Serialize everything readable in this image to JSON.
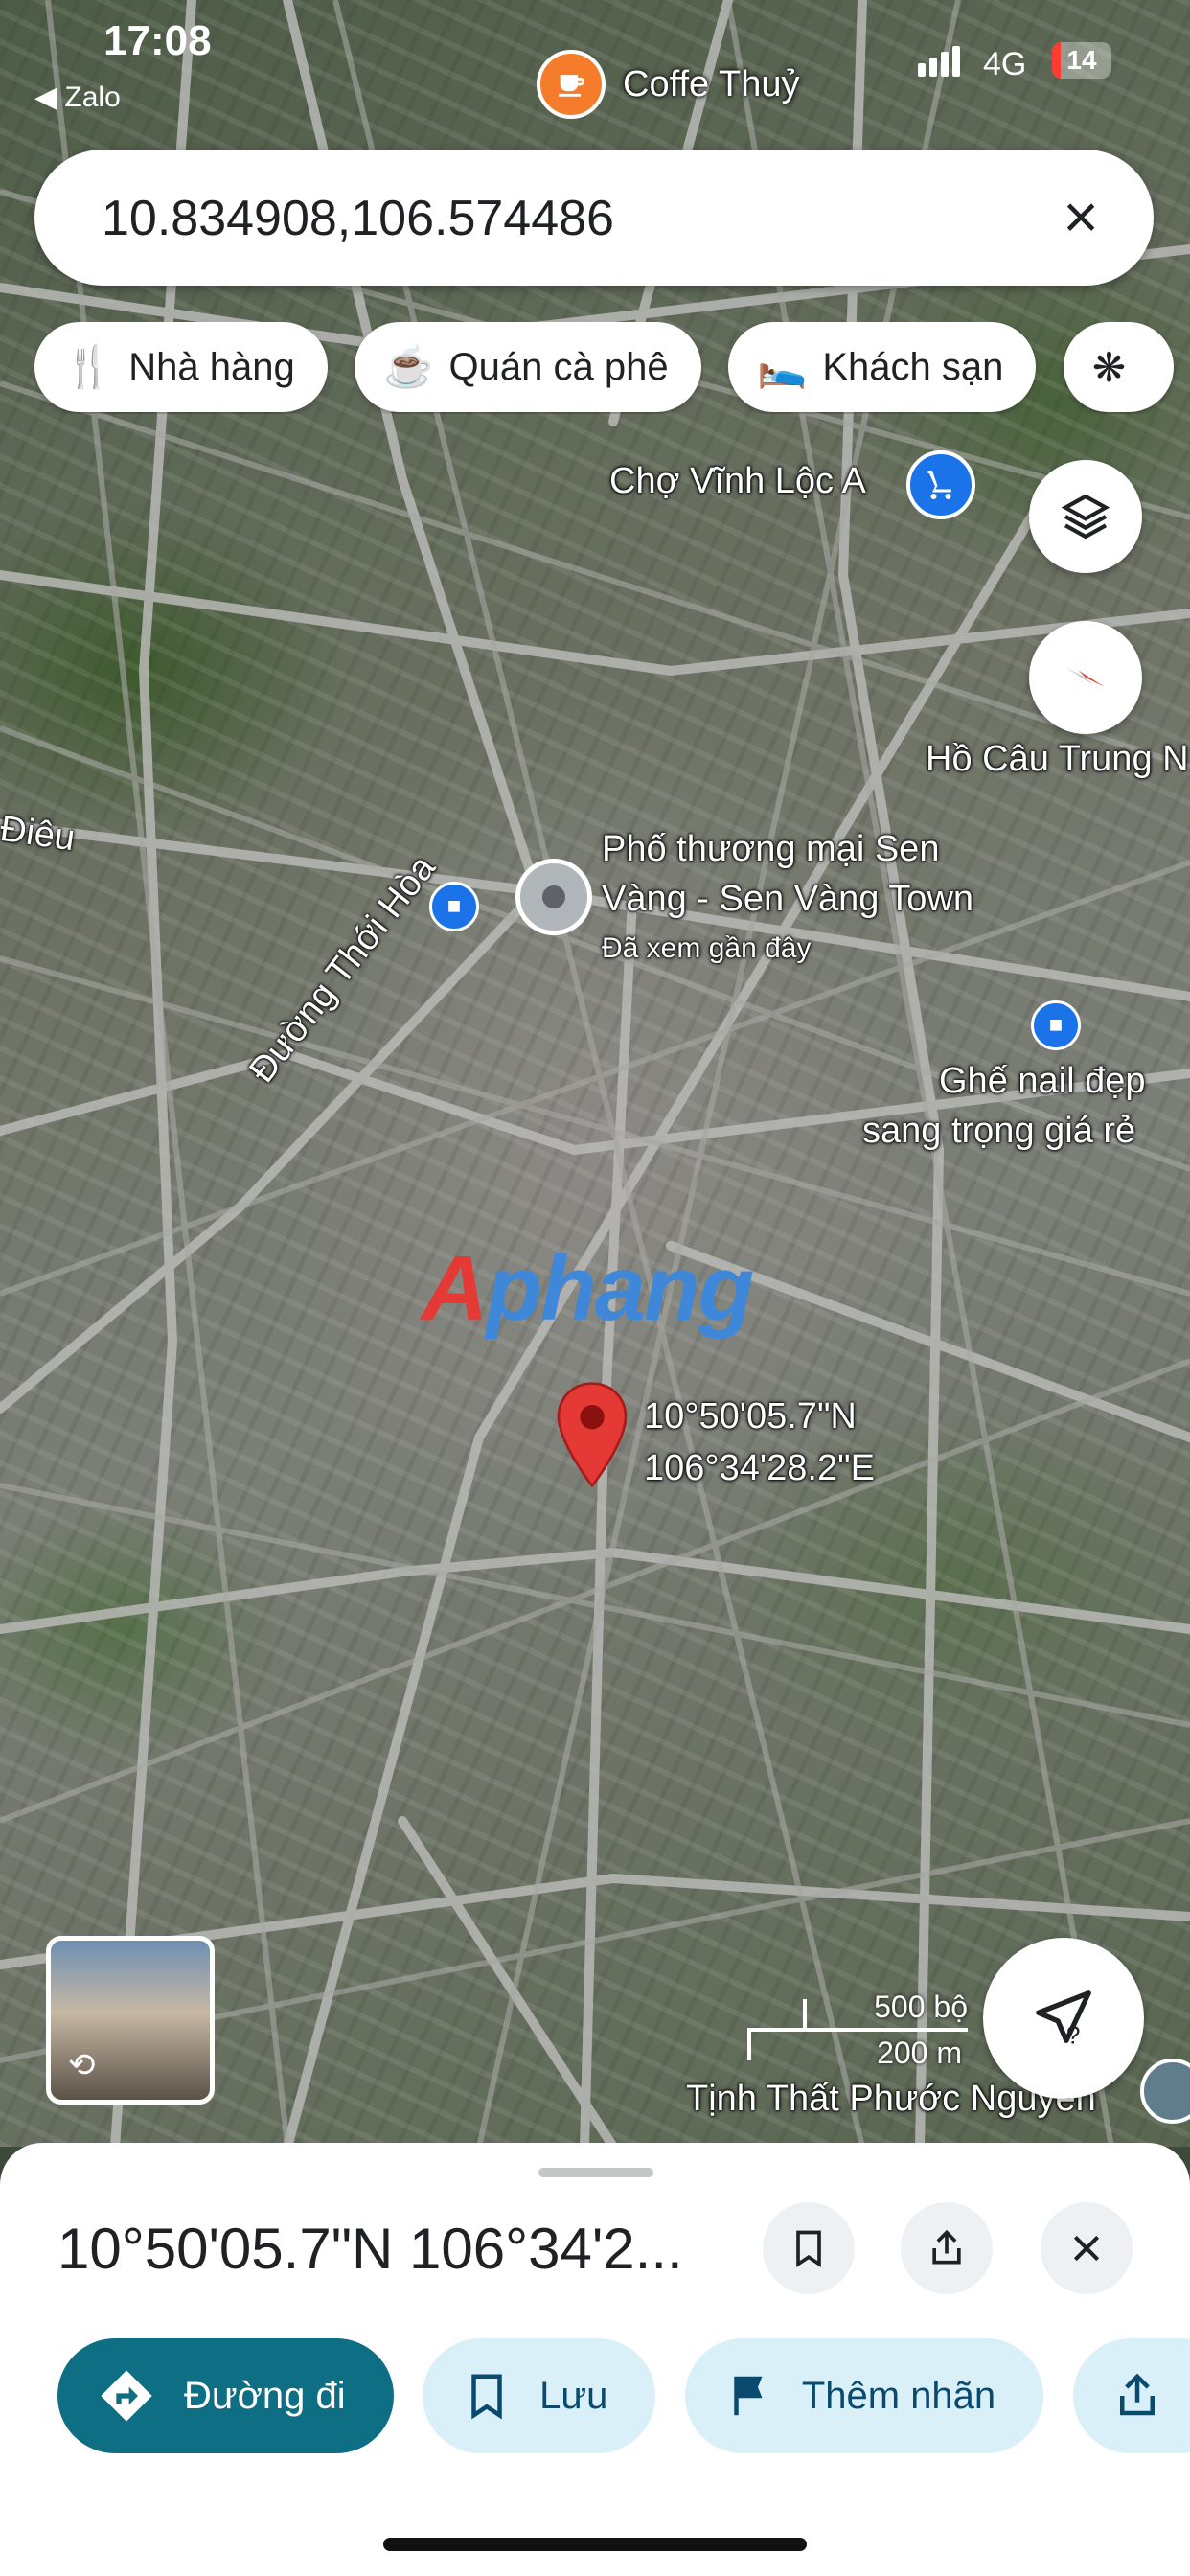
{
  "status_bar": {
    "time": "17:08",
    "back_app": "Zalo",
    "network": "4G",
    "battery": "14",
    "battery_level": 0.14
  },
  "top_poi": {
    "label": "Coffe Thuỷ"
  },
  "search": {
    "value": "10.834908,106.574486"
  },
  "chips": [
    {
      "label": "Nhà hàng",
      "icon": "fork-knife-icon"
    },
    {
      "label": "Quán cà phê",
      "icon": "coffee-cup-icon"
    },
    {
      "label": "Khách sạn",
      "icon": "bed-icon"
    }
  ],
  "map": {
    "labels": {
      "market": "Chợ Vĩnh Lộc A",
      "fishing": "Hồ Câu Trung N",
      "road_left": "Điêu",
      "commercial_1": "Phố thương mại Sen",
      "commercial_2": "Vàng - Sen Vàng Town",
      "recent": "Đã xem gần đây",
      "road_thoi_hoa": "Đường Thới Hòa",
      "nail_1": "Ghế nail đẹp",
      "nail_2": "sang trọng giá rẻ",
      "temple": "Tịnh Thất Phước Nguyên"
    },
    "pin": {
      "lat": "10°50'05.7\"N",
      "lng": "106°34'28.2\"E"
    },
    "watermark": {
      "part1": "A",
      "part2": "phang"
    },
    "scale": {
      "imperial": "500 bộ",
      "metric": "200 m"
    }
  },
  "sheet": {
    "title": "10°50'05.7\"N 106°34'2...",
    "actions": [
      {
        "label": "Đường đi"
      },
      {
        "label": "Lưu"
      },
      {
        "label": "Thêm nhãn"
      }
    ]
  }
}
